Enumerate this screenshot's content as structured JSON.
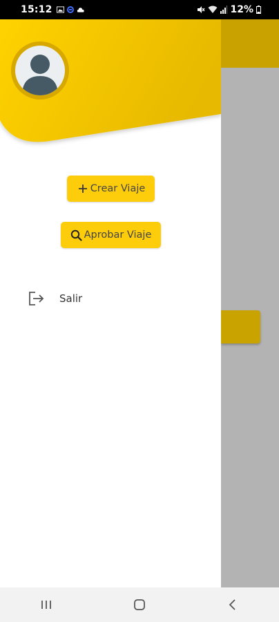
{
  "status_bar": {
    "time": "15:12",
    "battery": "12%",
    "icons": [
      "image-icon",
      "vpn-icon",
      "cloud-icon",
      "mute-icon",
      "wifi-icon",
      "signal-icon",
      "battery-icon"
    ]
  },
  "drawer": {
    "avatar_icon": "user-avatar-icon",
    "actions": {
      "crear_label": "Crear Viaje",
      "crear_icon": "plus-icon",
      "aprobar_label": "Aprobar Viaje",
      "aprobar_icon": "search-icon"
    },
    "menu": {
      "salir_label": "Salir",
      "salir_icon": "logout-icon"
    }
  },
  "colors": {
    "accent": "#fdcd0b",
    "header_gradient_start": "#ffd200",
    "header_gradient_end": "#e7b900",
    "scrim": "#b3b3b3"
  },
  "nav_bar": {
    "recents_icon": "recents-icon",
    "home_icon": "home-icon",
    "back_icon": "back-icon"
  }
}
